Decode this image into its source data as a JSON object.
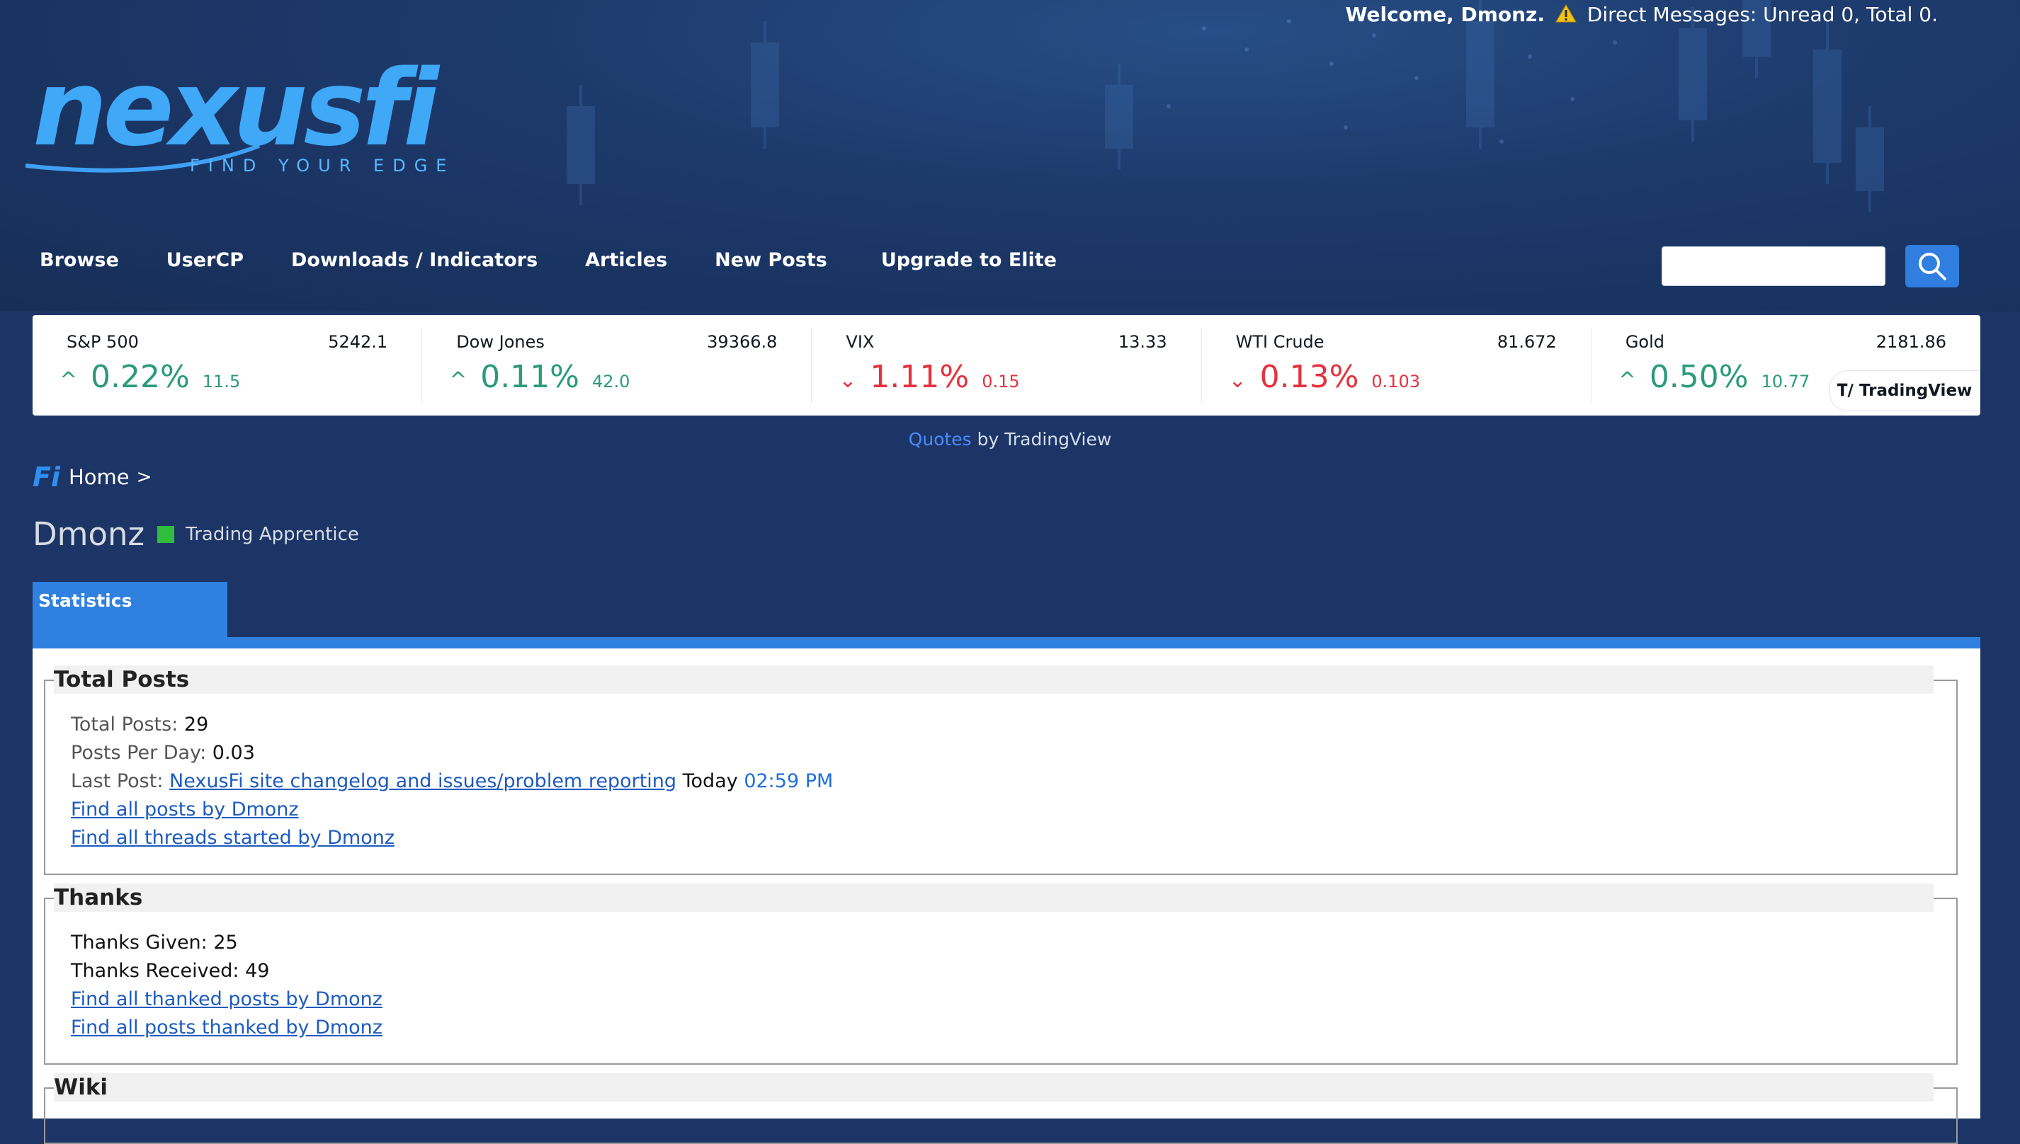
{
  "header": {
    "welcome_prefix": "Welcome, Dmonz.",
    "messages_text": "Direct Messages: Unread 0, Total 0.",
    "logo_text": "nexusfi",
    "logo_tagline": "FIND YOUR EDGE"
  },
  "nav": {
    "items": [
      "Browse",
      "UserCP",
      "Downloads / Indicators",
      "Articles",
      "New Posts",
      "Upgrade to Elite"
    ]
  },
  "search": {
    "placeholder": ""
  },
  "ticker": {
    "items": [
      {
        "name": "S&P 500",
        "price": "5242.1",
        "pct": "0.22%",
        "change": "11.5",
        "direction": "up"
      },
      {
        "name": "Dow Jones",
        "price": "39366.8",
        "pct": "0.11%",
        "change": "42.0",
        "direction": "up"
      },
      {
        "name": "VIX",
        "price": "13.33",
        "pct": "1.11%",
        "change": "0.15",
        "direction": "down"
      },
      {
        "name": "WTI Crude",
        "price": "81.672",
        "pct": "0.13%",
        "change": "0.103",
        "direction": "down"
      },
      {
        "name": "Gold",
        "price": "2181.86",
        "pct": "0.50%",
        "change": "10.77",
        "direction": "up"
      }
    ],
    "badge": "TradingView"
  },
  "quotes": {
    "link": "Quotes",
    "suffix": " by TradingView"
  },
  "breadcrumb": {
    "icon_text": "Fi",
    "home": "Home",
    "sep": ">"
  },
  "profile": {
    "username": "Dmonz",
    "rank": "Trading Apprentice",
    "status_color": "#2fbd3b"
  },
  "tabs": {
    "active": "Statistics"
  },
  "total_posts": {
    "title": "Total Posts",
    "total_label": "Total Posts:",
    "total_value": "29",
    "per_day_label": "Posts Per Day:",
    "per_day_value": "0.03",
    "last_post_label": "Last Post:",
    "last_post_link": "NexusFi site changelog and issues/problem reporting",
    "last_post_day": "Today",
    "last_post_time": "02:59 PM",
    "find_posts": "Find all posts by Dmonz",
    "find_threads": "Find all threads started by Dmonz"
  },
  "thanks": {
    "title": "Thanks",
    "given_label": "Thanks Given:",
    "given_value": "25",
    "received_label": "Thanks Received:",
    "received_value": "49",
    "find_thanked": "Find all thanked posts by Dmonz",
    "find_posts_thanked": "Find all posts thanked by Dmonz"
  },
  "wiki": {
    "title": "Wiki"
  },
  "colors": {
    "accent": "#2f80df",
    "up": "#2b9b7a",
    "down": "#e5323e",
    "background": "#1c3566"
  }
}
